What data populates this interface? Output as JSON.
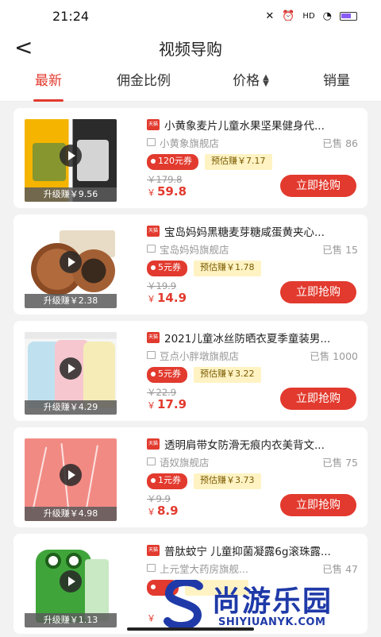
{
  "status": {
    "time": "21:24"
  },
  "nav": {
    "back": "<",
    "title": "视频导购"
  },
  "tabs": [
    {
      "label": "最新",
      "active": true
    },
    {
      "label": "佣金比例"
    },
    {
      "label": "价格"
    },
    {
      "label": "销量"
    }
  ],
  "products": [
    {
      "title": "小黄象麦片儿童水果坚果健身代...",
      "shop": "小黄象旗舰店",
      "sold": "已售 86",
      "coupon": "120元券",
      "estimate": "预估赚￥7.17",
      "original": "￥179.8",
      "price_symbol": "￥",
      "price": "59.8",
      "upgrade": "升级赚￥9.56",
      "buy": "立即抢购",
      "tmall": "天猫"
    },
    {
      "title": "宝岛妈妈黑糖麦芽糖咸蛋黄夹心...",
      "shop": "宝岛妈妈旗舰店",
      "sold": "已售 15",
      "coupon": "5元券",
      "estimate": "预估赚￥1.78",
      "original": "￥19.9",
      "price_symbol": "￥",
      "price": "14.9",
      "upgrade": "升级赚￥2.38",
      "buy": "立即抢购",
      "tmall": "天猫"
    },
    {
      "title": "2021儿童冰丝防晒衣夏季童装男...",
      "shop": "豆点小胖墩旗舰店",
      "sold": "已售 1000",
      "coupon": "5元券",
      "estimate": "预估赚￥3.22",
      "original": "￥22.9",
      "price_symbol": "￥",
      "price": "17.9",
      "upgrade": "升级赚￥4.29",
      "buy": "立即抢购",
      "tmall": "天猫"
    },
    {
      "title": "透明肩带女防滑无痕内衣美背文...",
      "shop": "语奴旗舰店",
      "sold": "已售 75",
      "coupon": "1元券",
      "estimate": "预估赚￥3.73",
      "original": "￥9.9",
      "price_symbol": "￥",
      "price": "8.9",
      "upgrade": "升级赚￥4.98",
      "buy": "立即抢购",
      "tmall": "天猫"
    },
    {
      "title": "普肽蚊宁 儿童抑菌凝露6g滚珠露...",
      "shop": "上元堂大药房旗舰...",
      "sold": "已售 47",
      "coupon": "",
      "estimate": "",
      "original": "",
      "price_symbol": "￥",
      "price": "",
      "upgrade": "升级赚￥1.13",
      "buy": "",
      "tmall": "天猫"
    }
  ],
  "watermark": {
    "brand": "尚游乐园",
    "domain": "SHIYIUANYK.COM"
  },
  "colors": {
    "accent": "#e23a2e",
    "coupon_bg": "#e23a2e",
    "estimate_bg": "#fff3c4",
    "watermark": "#1f3aa8"
  }
}
